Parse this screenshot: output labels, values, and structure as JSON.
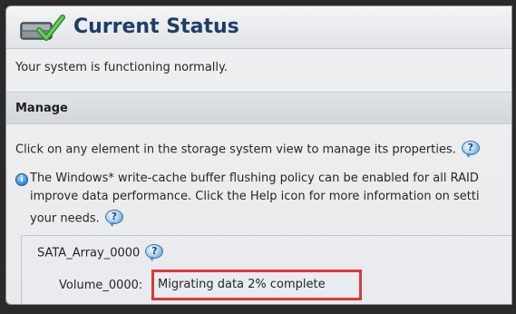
{
  "header": {
    "title": "Current Status",
    "icon": "storage-check-icon"
  },
  "status": {
    "message": "Your system is functioning normally."
  },
  "manage": {
    "section_label": "Manage",
    "instruction": "Click on any element in the storage system view to manage its properties.",
    "policy_line1": "The Windows* write-cache buffer flushing policy can be enabled for all RAID",
    "policy_line2": "improve data performance. Click the Help icon for more information on setti",
    "policy_line3": "your needs."
  },
  "array": {
    "name": "SATA_Array_0000",
    "volume_label": "Volume_0000:",
    "volume_status": "Migrating data 2% complete"
  },
  "colors": {
    "title": "#1e3e63",
    "highlight_border": "#d83a3a",
    "help_icon": "#4e8fcb"
  }
}
